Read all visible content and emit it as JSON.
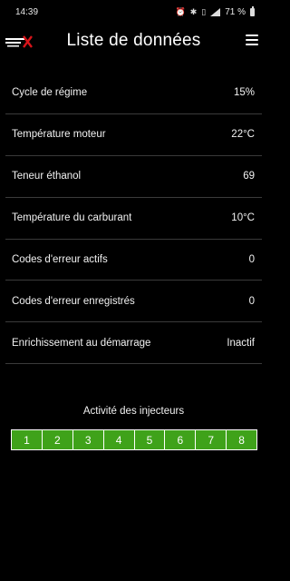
{
  "status_bar": {
    "time": "14:39",
    "icons": [
      "alarm-icon",
      "bluetooth-icon",
      "vibrate-icon",
      "signal-icon"
    ],
    "battery": "71 %"
  },
  "header": {
    "title": "Liste de données",
    "logo_text": "FLEX",
    "menu_icon": "hamburger-menu-icon"
  },
  "data_rows": [
    {
      "label": "Cycle de régime",
      "value": "15%"
    },
    {
      "label": "Température moteur",
      "value": "22°C"
    },
    {
      "label": "Teneur éthanol",
      "value": "69"
    },
    {
      "label": "Température du carburant",
      "value": "10°C"
    },
    {
      "label": "Codes d'erreur actifs",
      "value": "0"
    },
    {
      "label": "Codes d'erreur enregistrés",
      "value": "0"
    },
    {
      "label": "Enrichissement au démarrage",
      "value": "Inactif"
    }
  ],
  "injectors": {
    "title": "Activité des injecteurs",
    "cells": [
      "1",
      "2",
      "3",
      "4",
      "5",
      "6",
      "7",
      "8"
    ],
    "active_color": "#3fa21a"
  }
}
